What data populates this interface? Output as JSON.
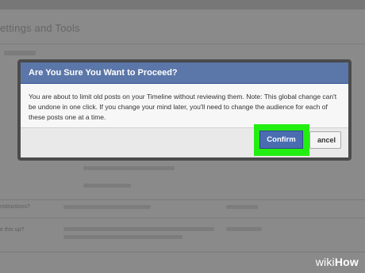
{
  "background": {
    "title": "ettings and Tools",
    "labels": [
      "nstructions?",
      "e this up?"
    ],
    "list_items": [
      "ow Facebook Friends Posts",
      "ck Limited Posts"
    ]
  },
  "dialog": {
    "title": "Are You Sure You Want to Proceed?",
    "body": "You are about to limit old posts on your Timeline without reviewing them. Note: This global change can't be undone in one click. If you change your mind later, you'll need to change the audience for each of these posts one at a time.",
    "confirm_label": "Confirm",
    "cancel_label": "ancel"
  },
  "watermark": {
    "wiki": "wiki",
    "how": "How"
  },
  "colors": {
    "highlight": "#22ee11",
    "header": "#5b77a9",
    "confirm": "#4a6db2"
  }
}
